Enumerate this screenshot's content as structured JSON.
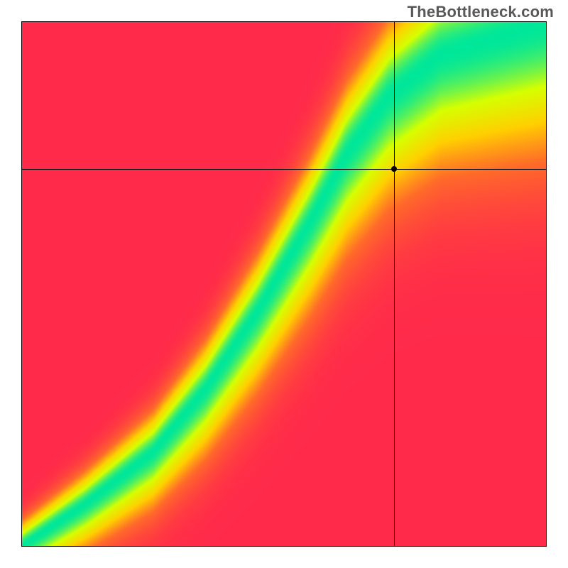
{
  "watermark": "TheBottleneck.com",
  "chart_data": {
    "type": "heatmap",
    "title": "",
    "xlabel": "",
    "ylabel": "",
    "xlim": [
      0,
      100
    ],
    "ylim": [
      0,
      100
    ],
    "color_scale": {
      "stops": [
        {
          "t": 0.0,
          "hex": "#ff2a4a"
        },
        {
          "t": 0.3,
          "hex": "#ff6a2a"
        },
        {
          "t": 0.55,
          "hex": "#ffd000"
        },
        {
          "t": 0.78,
          "hex": "#d6ff00"
        },
        {
          "t": 1.0,
          "hex": "#00e79a"
        }
      ]
    },
    "ridge": {
      "points": [
        {
          "x": 0,
          "y": 0
        },
        {
          "x": 12,
          "y": 8
        },
        {
          "x": 25,
          "y": 18
        },
        {
          "x": 35,
          "y": 30
        },
        {
          "x": 45,
          "y": 45
        },
        {
          "x": 55,
          "y": 62
        },
        {
          "x": 62,
          "y": 75
        },
        {
          "x": 70,
          "y": 86
        },
        {
          "x": 80,
          "y": 94
        },
        {
          "x": 100,
          "y": 100
        }
      ],
      "base_sigma": 3.0,
      "sigma_growth": 8.0,
      "asymmetry": 0.45
    },
    "marker": {
      "x": 71,
      "y": 72
    }
  }
}
